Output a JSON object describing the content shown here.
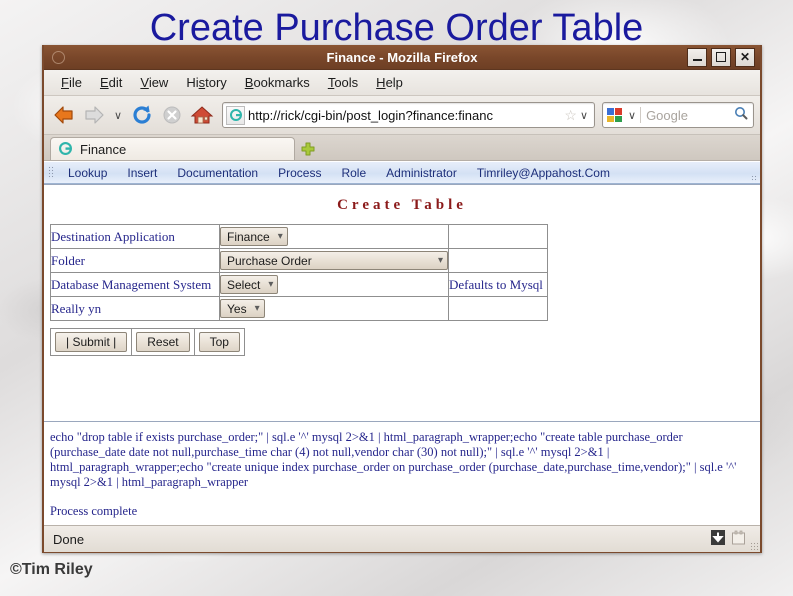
{
  "slide": {
    "title": "Create Purchase Order Table",
    "copyright": "©Tim Riley"
  },
  "browser": {
    "window_title": "Finance - Mozilla Firefox",
    "window_buttons": {
      "minimize": "–",
      "maximize": "□",
      "close": "✕"
    },
    "menu": [
      {
        "accel": "F",
        "rest": "ile"
      },
      {
        "accel": "E",
        "rest": "dit"
      },
      {
        "accel": "V",
        "rest": "iew"
      },
      {
        "accel": "H",
        "rest": "istory",
        "pre": "Hi",
        "accel2": "s",
        "rest2": "tory"
      },
      {
        "accel": "B",
        "rest": "ookmarks"
      },
      {
        "accel": "T",
        "rest": "ools"
      },
      {
        "accel": "H",
        "rest": "elp"
      }
    ],
    "menu_labels": [
      "File",
      "Edit",
      "View",
      "History",
      "Bookmarks",
      "Tools",
      "Help"
    ],
    "nav": {
      "back_icon": "back-arrow-icon",
      "forward_icon": "forward-arrow-icon",
      "history_chevron": "∨",
      "reload_icon": "reload-icon",
      "stop_icon": "stop-icon",
      "home_icon": "home-icon"
    },
    "url": "http://rick/cgi-bin/post_login?finance:financ",
    "url_star": "☆",
    "url_chevron": "∨",
    "search_placeholder": "Google",
    "search_chevron": "∨",
    "tab": {
      "label": "Finance",
      "new_tab_glyph": "+"
    },
    "bookmarks": [
      "Lookup",
      "Insert",
      "Documentation",
      "Process",
      "Role",
      "Administrator",
      "Timriley@Appahost.Com"
    ],
    "status": {
      "text": "Done",
      "download_icon": "download-arrow-icon",
      "notepad_icon": "notepad-icon"
    }
  },
  "page": {
    "heading": "Create Table",
    "rows": [
      {
        "label": "Destination Application",
        "value": "Finance",
        "wide": false,
        "note": ""
      },
      {
        "label": "Folder",
        "value": "Purchase Order",
        "wide": true,
        "note": ""
      },
      {
        "label": "Database Management System",
        "value": "Select",
        "wide": false,
        "note": "Defaults to Mysql"
      },
      {
        "label": "Really yn",
        "value": "Yes",
        "wide": false,
        "note": ""
      }
    ],
    "buttons": [
      {
        "label": "|  Submit  |"
      },
      {
        "label": "Reset"
      },
      {
        "label": "Top"
      }
    ],
    "output_text": "echo \"drop table if exists purchase_order;\" | sql.e '^' mysql 2>&1 | html_paragraph_wrapper;echo \"create table purchase_order (purchase_date date not null,purchase_time char (4) not null,vendor char (30) not null);\" | sql.e '^' mysql 2>&1 | html_paragraph_wrapper;echo \"create unique index purchase_order on purchase_order (purchase_date,purchase_time,vendor);\" | sql.e '^' mysql 2>&1 | html_paragraph_wrapper",
    "output_status": "Process complete"
  },
  "colors": {
    "title_blue": "#1a1a9e",
    "titlebar_brown": "#7a472a",
    "heading_red": "#8b1a1a",
    "form_text_blue": "#26268c",
    "bookmark_blue": "#1d2f7a"
  }
}
